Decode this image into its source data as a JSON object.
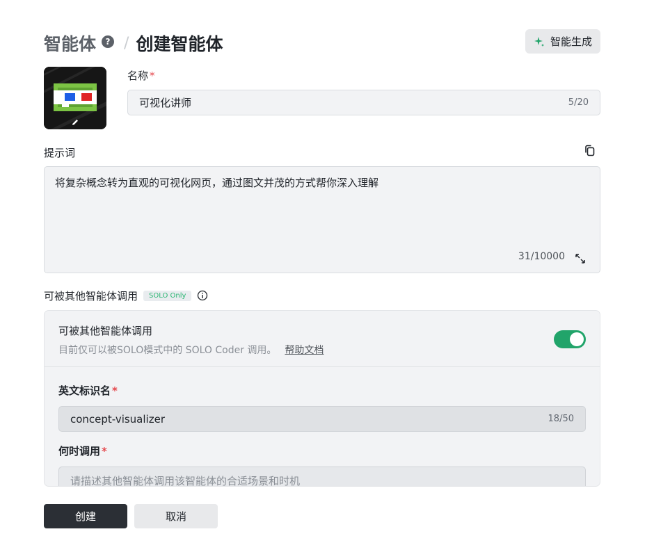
{
  "header": {
    "breadcrumb_parent": "智能体",
    "help_icon": "?",
    "separator": "/",
    "breadcrumb_current": "创建智能体",
    "generate_button": "智能生成",
    "generate_icon": "sparkle-icon",
    "accent_color": "#21a46a"
  },
  "avatar": {
    "icon": "pixel-3d-glasses-avatar",
    "edit_icon": "pencil-icon"
  },
  "name_field": {
    "label": "名称",
    "required_mark": "*",
    "value": "可视化讲师",
    "counter": "5/20"
  },
  "prompt": {
    "label": "提示词",
    "copy_icon": "copy-icon",
    "value": "将复杂概念转为直观的可视化网页，通过图文并茂的方式帮你深入理解",
    "counter": "31/10000",
    "expand_icon": "expand-icon"
  },
  "callable": {
    "label": "可被其他智能体调用",
    "tag": "SOLO Only",
    "info_icon": "info-icon",
    "panel_title": "可被其他智能体调用",
    "panel_desc": "目前仅可以被SOLO模式中的 SOLO Coder 调用。",
    "doc_link": "帮助文档",
    "toggle_on": true,
    "english_id": {
      "label": "英文标识名",
      "required_mark": "*",
      "value": "concept-visualizer",
      "counter": "18/50"
    },
    "when_to_call": {
      "label": "何时调用",
      "required_mark": "*",
      "placeholder": "请描述其他智能体调用该智能体的合适场景和时机"
    }
  },
  "actions": {
    "create": "创建",
    "cancel": "取消"
  }
}
